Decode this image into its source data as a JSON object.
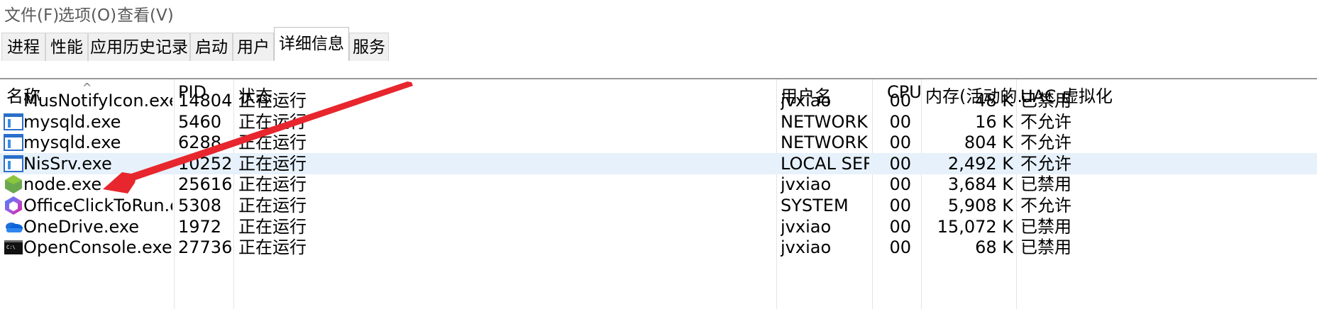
{
  "menu": [
    "文件(F)",
    "选项(O)",
    "查看(V)"
  ],
  "tabs": [
    "进程",
    "性能",
    "应用历史记录",
    "启动",
    "用户",
    "详细信息",
    "服务"
  ],
  "active_tab": "详细信息",
  "columns": {
    "name": "名称",
    "pid": "PID",
    "status": "状态",
    "user": "用户名",
    "cpu": "CPU",
    "memory": "内存(活动的...",
    "uac": "UAC 虚拟化"
  },
  "sort_indicator": "^",
  "rows": [
    {
      "icon": "blank-icon",
      "name": "MusNotifyIcon.exe",
      "pid": "14804",
      "status": "正在运行",
      "user": "jvxiao",
      "cpu": "00",
      "memory": "48 K",
      "uac": "已禁用"
    },
    {
      "icon": "window-app-icon",
      "name": "mysqld.exe",
      "pid": "5460",
      "status": "正在运行",
      "user": "NETWORK...",
      "cpu": "00",
      "memory": "16 K",
      "uac": "不允许"
    },
    {
      "icon": "window-app-icon",
      "name": "mysqld.exe",
      "pid": "6288",
      "status": "正在运行",
      "user": "NETWORK...",
      "cpu": "00",
      "memory": "804 K",
      "uac": "不允许"
    },
    {
      "icon": "window-app-icon",
      "name": "NisSrv.exe",
      "pid": "10252",
      "status": "正在运行",
      "user": "LOCAL SER...",
      "cpu": "00",
      "memory": "2,492 K",
      "uac": "不允许",
      "selected": true
    },
    {
      "icon": "nodejs-hexagon-icon",
      "name": "node.exe",
      "pid": "25616",
      "status": "正在运行",
      "user": "jvxiao",
      "cpu": "00",
      "memory": "3,684 K",
      "uac": "已禁用"
    },
    {
      "icon": "office-logo-icon",
      "name": "OfficeClickToRun.exe",
      "pid": "5308",
      "status": "正在运行",
      "user": "SYSTEM",
      "cpu": "00",
      "memory": "5,908 K",
      "uac": "不允许"
    },
    {
      "icon": "onedrive-cloud-icon",
      "name": "OneDrive.exe",
      "pid": "1972",
      "status": "正在运行",
      "user": "jvxiao",
      "cpu": "00",
      "memory": "15,072 K",
      "uac": "已禁用"
    },
    {
      "icon": "console-icon",
      "name": "OpenConsole.exe",
      "pid": "27736",
      "status": "正在运行",
      "user": "jvxiao",
      "cpu": "00",
      "memory": "68 K",
      "uac": "已禁用"
    }
  ],
  "colors": {
    "annotation_arrow": "#e8262d",
    "selected_row": "#e6f1fb"
  }
}
